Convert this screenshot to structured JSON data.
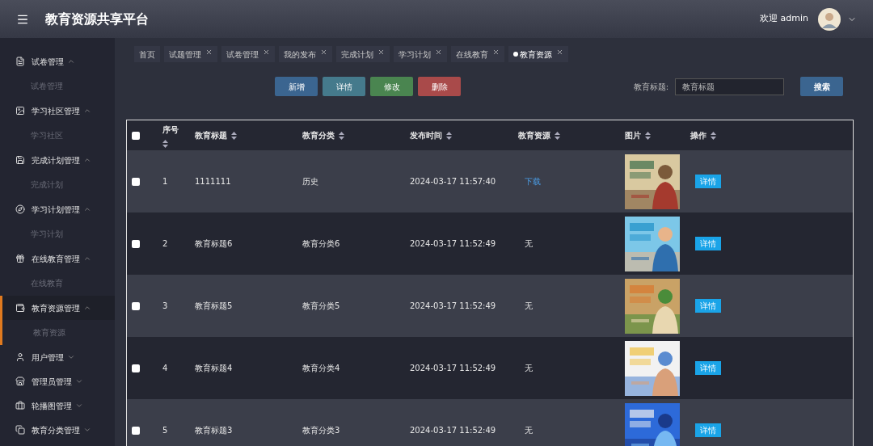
{
  "header": {
    "title": "教育资源共享平台",
    "welcome": "欢迎 admin"
  },
  "sidebar": {
    "items": [
      {
        "label": "试卷管理",
        "expanded": true,
        "selected": false,
        "children": [
          {
            "label": "试卷管理",
            "selected": false
          }
        ]
      },
      {
        "label": "学习社区管理",
        "expanded": true,
        "selected": false,
        "children": [
          {
            "label": "学习社区",
            "selected": false
          }
        ]
      },
      {
        "label": "完成计划管理",
        "expanded": true,
        "selected": false,
        "children": [
          {
            "label": "完成计划",
            "selected": false
          }
        ]
      },
      {
        "label": "学习计划管理",
        "expanded": true,
        "selected": false,
        "children": [
          {
            "label": "学习计划",
            "selected": false
          }
        ]
      },
      {
        "label": "在线教育管理",
        "expanded": true,
        "selected": false,
        "children": [
          {
            "label": "在线教育",
            "selected": false
          }
        ]
      },
      {
        "label": "教育资源管理",
        "expanded": true,
        "selected": true,
        "children": [
          {
            "label": "教育资源",
            "selected": false
          }
        ]
      },
      {
        "label": "用户管理",
        "expanded": false,
        "selected": false
      },
      {
        "label": "管理员管理",
        "expanded": false,
        "selected": false
      },
      {
        "label": "轮播图管理",
        "expanded": false,
        "selected": false
      },
      {
        "label": "教育分类管理",
        "expanded": false,
        "selected": false
      }
    ]
  },
  "tags": [
    {
      "label": "首页",
      "selected": false,
      "closable": false
    },
    {
      "label": "试题管理",
      "selected": false,
      "closable": true
    },
    {
      "label": "试卷管理",
      "selected": false,
      "closable": true
    },
    {
      "label": "我的发布",
      "selected": false,
      "closable": true
    },
    {
      "label": "完成计划",
      "selected": false,
      "closable": true
    },
    {
      "label": "学习计划",
      "selected": false,
      "closable": true
    },
    {
      "label": "在线教育",
      "selected": false,
      "closable": true
    },
    {
      "label": "教育资源",
      "selected": true,
      "closable": true
    }
  ],
  "toolbar": {
    "buttons": [
      {
        "label": "新增",
        "kind": "add"
      },
      {
        "label": "详情",
        "kind": "detail"
      },
      {
        "label": "修改",
        "kind": "edit"
      },
      {
        "label": "删除",
        "kind": "delete"
      }
    ]
  },
  "search": {
    "label": "教育标题:",
    "placeholder": "教育标题",
    "button": "搜索"
  },
  "table": {
    "select_all": {
      "checked": false
    },
    "columns": [
      {
        "label": "序号",
        "sortable": true
      },
      {
        "label": "教育标题",
        "sortable": true
      },
      {
        "label": "教育分类",
        "sortable": true
      },
      {
        "label": "发布时间",
        "sortable": true
      },
      {
        "label": "教育资源",
        "sortable": true
      },
      {
        "label": "图片",
        "sortable": true
      },
      {
        "label": "操作",
        "sortable": true
      }
    ],
    "rows": [
      {
        "checked": false,
        "index": "1",
        "title": "1111111",
        "category": "历史",
        "time": "2024-03-17 11:57:40",
        "resource": {
          "text": "下载",
          "kind": "link"
        },
        "action": "详情"
      },
      {
        "checked": false,
        "index": "2",
        "title": "教育标题6",
        "category": "教育分类6",
        "time": "2024-03-17 11:52:49",
        "resource": {
          "text": "无",
          "kind": "plain"
        },
        "action": "详情"
      },
      {
        "checked": false,
        "index": "3",
        "title": "教育标题5",
        "category": "教育分类5",
        "time": "2024-03-17 11:52:49",
        "resource": {
          "text": "无",
          "kind": "plain"
        },
        "action": "详情"
      },
      {
        "checked": false,
        "index": "4",
        "title": "教育标题4",
        "category": "教育分类4",
        "time": "2024-03-17 11:52:49",
        "resource": {
          "text": "无",
          "kind": "plain"
        },
        "action": "详情"
      },
      {
        "checked": false,
        "index": "5",
        "title": "教育标题3",
        "category": "教育分类3",
        "time": "2024-03-17 11:52:49",
        "resource": {
          "text": "无",
          "kind": "plain"
        },
        "action": "详情"
      }
    ]
  }
}
